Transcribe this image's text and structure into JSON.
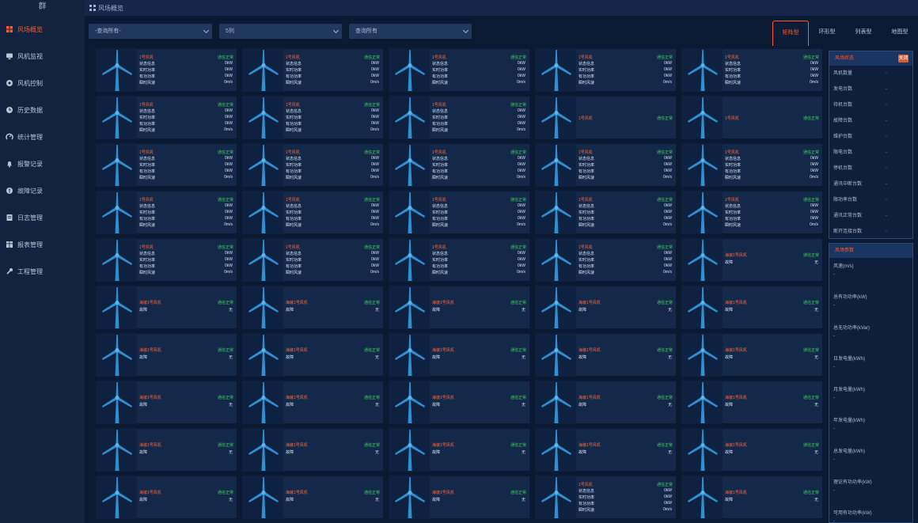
{
  "logo": "群",
  "nav": [
    {
      "label": "风场概览",
      "icon": "grid-icon",
      "active": true
    },
    {
      "label": "风机监视",
      "icon": "monitor-icon"
    },
    {
      "label": "风机控制",
      "icon": "control-icon"
    },
    {
      "label": "历史数据",
      "icon": "history-icon"
    },
    {
      "label": "统计管理",
      "icon": "stats-icon"
    },
    {
      "label": "报警记录",
      "icon": "bell-icon"
    },
    {
      "label": "故障记录",
      "icon": "fault-icon"
    },
    {
      "label": "日志管理",
      "icon": "log-icon"
    },
    {
      "label": "报表管理",
      "icon": "report-icon"
    },
    {
      "label": "工程管理",
      "icon": "wrench-icon"
    }
  ],
  "header": {
    "title": "风场概览"
  },
  "filters": {
    "select1": "-查询所有-",
    "select2": "5列",
    "select3": "查询所有"
  },
  "view_tabs": [
    {
      "label": "矩阵型",
      "active": true
    },
    {
      "label": "环形型"
    },
    {
      "label": "列表型"
    },
    {
      "label": "地图型"
    }
  ],
  "card_rows": [
    [
      "full",
      "full",
      "full",
      "full",
      "full"
    ],
    [
      "full",
      "full",
      "full",
      "name",
      "name"
    ],
    [
      "full",
      "full",
      "full",
      "full",
      "full"
    ],
    [
      "full",
      "full",
      "full",
      "full",
      "full"
    ],
    [
      "full",
      "full",
      "full",
      "full",
      "compact"
    ],
    [
      "compact",
      "compact",
      "compact",
      "compact",
      "compact"
    ],
    [
      "compact",
      "compact",
      "compact",
      "compact",
      "compact"
    ],
    [
      "compact",
      "compact",
      "compact",
      "compact",
      "compact"
    ],
    [
      "compact",
      "compact",
      "compact",
      "compact",
      "compact"
    ],
    [
      "compact",
      "compact",
      "compact",
      "full",
      "compact"
    ]
  ],
  "card_text": {
    "name": "1号风机",
    "compact_name": "海装1号风机",
    "status": "通信正常",
    "rows": [
      "状态信息",
      "实时功率",
      "有功功率",
      "瞬时风速"
    ],
    "values": [
      "0kW",
      "0kW",
      "0kW",
      "0m/s"
    ],
    "compact_row": "故障",
    "compact_value": "无"
  },
  "panel": {
    "stats_title": "风场状态",
    "close_label": "关闭",
    "stats": [
      {
        "label": "风机数量",
        "value": "-"
      },
      {
        "label": "发电台数",
        "value": "-"
      },
      {
        "label": "待机台数",
        "value": "-"
      },
      {
        "label": "故障台数",
        "value": "-"
      },
      {
        "label": "维护台数",
        "value": "-"
      },
      {
        "label": "限电台数",
        "value": "-"
      },
      {
        "label": "停机台数",
        "value": "-"
      },
      {
        "label": "通讯中断台数",
        "value": "-"
      },
      {
        "label": "限功率台数",
        "value": "-"
      },
      {
        "label": "通讯正常台数",
        "value": "-"
      },
      {
        "label": "断开连接台数",
        "value": "-"
      }
    ],
    "params_title": "风场参数",
    "params": [
      {
        "label": "风速(m/s)",
        "value": "-"
      },
      {
        "label": "总有功功率(kW)",
        "value": "-"
      },
      {
        "label": "总无功功率(kVar)",
        "value": "-"
      },
      {
        "label": "日发电量(kWh)",
        "value": "-"
      },
      {
        "label": "月发电量(kWh)",
        "value": "-"
      },
      {
        "label": "年发电量(kWh)",
        "value": "-"
      },
      {
        "label": "总发电量(kWh)",
        "value": "-"
      },
      {
        "label": "理论有功功率(kW)",
        "value": "-"
      },
      {
        "label": "可用有功功率(kW)",
        "value": "-"
      }
    ]
  },
  "colors": {
    "accent": "#ff5a2a",
    "ok": "#3fd25a",
    "turbine": "#2f8fd0",
    "bg": "#0b1a33"
  }
}
